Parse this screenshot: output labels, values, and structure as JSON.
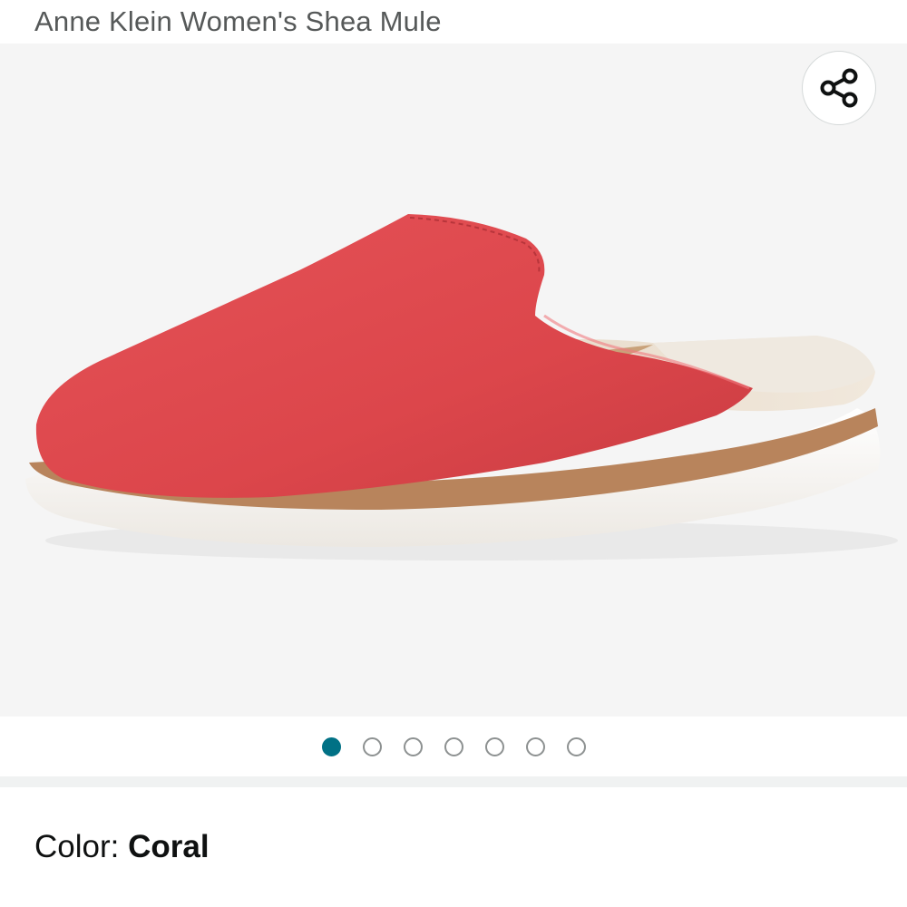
{
  "product": {
    "title": "Anne Klein Women's Shea Mule"
  },
  "gallery": {
    "image_count": 7,
    "active_index": 0,
    "share_icon": "share-icon"
  },
  "variation": {
    "label": "Color: ",
    "value": "Coral"
  },
  "colors": {
    "accent": "#007185",
    "shoe": "#e0474c"
  }
}
